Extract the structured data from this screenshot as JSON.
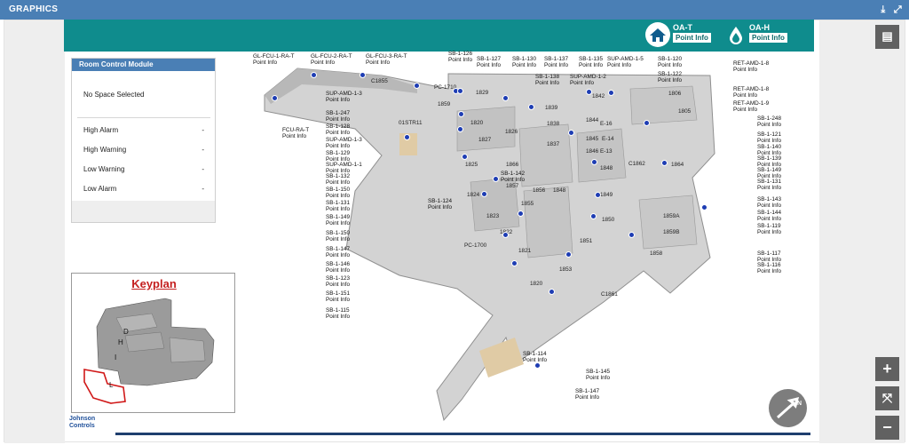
{
  "panel": {
    "title": "GRAPHICS",
    "download_icon": "download-icon",
    "expand_icon": "expand-icon"
  },
  "header": {
    "oa_t": {
      "title": "OA-T",
      "point": "Point Info"
    },
    "oa_h": {
      "title": "OA-H",
      "point": "Point Info"
    },
    "home_icon": "home-icon",
    "drop_icon": "humidity-drop-icon"
  },
  "rcm": {
    "title": "Room Control Module",
    "no_space": "No Space Selected",
    "rows": [
      {
        "label": "High Alarm",
        "value": "-"
      },
      {
        "label": "High Warning",
        "value": "-"
      },
      {
        "label": "Low Warning",
        "value": "-"
      },
      {
        "label": "Low Alarm",
        "value": "-"
      }
    ]
  },
  "keyplan": {
    "title": "Keyplan",
    "sections": [
      "D",
      "H",
      "I",
      "L"
    ]
  },
  "logo": {
    "line1": "Johnson",
    "line2": "Controls"
  },
  "controls": {
    "zoom_in": "+",
    "zoom_out": "−",
    "fit": "⤧"
  },
  "compass": {
    "label": "N"
  },
  "labels_left": [
    {
      "name": "GL-FCU-1-RA-T",
      "sub": "Point Info"
    },
    {
      "name": "GL-FCU-2-RA-T",
      "sub": "Point Info"
    },
    {
      "name": "GL-FCU-3-RA-T",
      "sub": "Point Info"
    },
    {
      "name": "SUP-AMD-1-3",
      "sub": "Point Info"
    },
    {
      "name": "SB-1-247",
      "sub": "Point Info"
    },
    {
      "name": "FCU-RA-T",
      "sub": "Point Info"
    },
    {
      "name": "SB-1-128",
      "sub": "Point Info"
    },
    {
      "name": "SUP-AMD-1-3",
      "sub": "Point Info"
    },
    {
      "name": "SB-1-129",
      "sub": "Point Info"
    },
    {
      "name": "SUP-AMD-1-1",
      "sub": "Point Info"
    },
    {
      "name": "SB-1-132",
      "sub": "Point Info"
    },
    {
      "name": "SB-1-150",
      "sub": "Point Info"
    },
    {
      "name": "SB-1-131",
      "sub": "Point Info"
    },
    {
      "name": "SB-1-149",
      "sub": "Point Info"
    },
    {
      "name": "SB-1-150",
      "sub": "Point Info"
    },
    {
      "name": "SB-1-147",
      "sub": "Point Info"
    },
    {
      "name": "SB-1-146",
      "sub": "Point Info"
    },
    {
      "name": "SB-1-123",
      "sub": "Point Info"
    },
    {
      "name": "SB-1-151",
      "sub": "Point Info"
    },
    {
      "name": "SB-1-115",
      "sub": "Point Info"
    }
  ],
  "labels_top": [
    {
      "name": "SB-1-126",
      "sub": "Point Info"
    },
    {
      "name": "SB-1-127",
      "sub": "Point Info"
    },
    {
      "name": "SB-1-130",
      "sub": "Point Info"
    },
    {
      "name": "SB-1-137",
      "sub": "Point Info"
    },
    {
      "name": "SB-1-138",
      "sub": "Point Info"
    },
    {
      "name": "SB-1-135",
      "sub": "Point Info"
    },
    {
      "name": "SUP-AMD-1-5",
      "sub": "Point Info"
    },
    {
      "name": "SUP-AMD-1-2",
      "sub": "Point Info"
    },
    {
      "name": "SB-1-120",
      "sub": "Point Info"
    },
    {
      "name": "SB-1-122",
      "sub": "Point Info"
    }
  ],
  "labels_right": [
    {
      "name": "RET-AMD-1-8",
      "sub": "Point Info"
    },
    {
      "name": "RET-AMD-1-8",
      "sub": "Point Info"
    },
    {
      "name": "RET-AMD-1-9",
      "sub": "Point Info"
    },
    {
      "name": "SB-1-248",
      "sub": "Point Info"
    },
    {
      "name": "SB-1-121",
      "sub": "Point Info"
    },
    {
      "name": "SB-1-140",
      "sub": "Point Info"
    },
    {
      "name": "SB-1-139",
      "sub": "Point Info"
    },
    {
      "name": "SB-1-149",
      "sub": "Point Info"
    },
    {
      "name": "SB-1-131",
      "sub": "Point Info"
    },
    {
      "name": "SB-1-143",
      "sub": "Point Info"
    },
    {
      "name": "SB-1-144",
      "sub": "Point Info"
    },
    {
      "name": "SB-1-119",
      "sub": "Point Info"
    },
    {
      "name": "SB-1-117",
      "sub": "Point Info"
    },
    {
      "name": "SB-1-116",
      "sub": "Point Info"
    }
  ],
  "labels_mid": [
    {
      "name": "SB-1-142",
      "sub": "Point Info"
    },
    {
      "name": "SB-1-124",
      "sub": "Point Info"
    },
    {
      "name": "SB-1-114",
      "sub": "Point Info"
    },
    {
      "name": "SB-1-145",
      "sub": "Point Info"
    },
    {
      "name": "SB-1-147",
      "sub": "Point Info"
    }
  ],
  "rooms": [
    "C1855",
    "PC-1710",
    "1829",
    "1859",
    "1839",
    "1842",
    "1806",
    "1805",
    "1826",
    "1827",
    "1820",
    "1838",
    "1825",
    "1837",
    "1844",
    "E-16",
    "1845",
    "E-14",
    "1846",
    "E-13",
    "1848",
    "C1862",
    "1864",
    "1866",
    "1857",
    "1856",
    "1848",
    "01STR11",
    "1824",
    "1823",
    "1855",
    "1849",
    "1850",
    "1859A",
    "1859B",
    "1822",
    "1851",
    "PC-1700",
    "1821",
    "1853",
    "1858",
    "1820",
    "C1861"
  ]
}
